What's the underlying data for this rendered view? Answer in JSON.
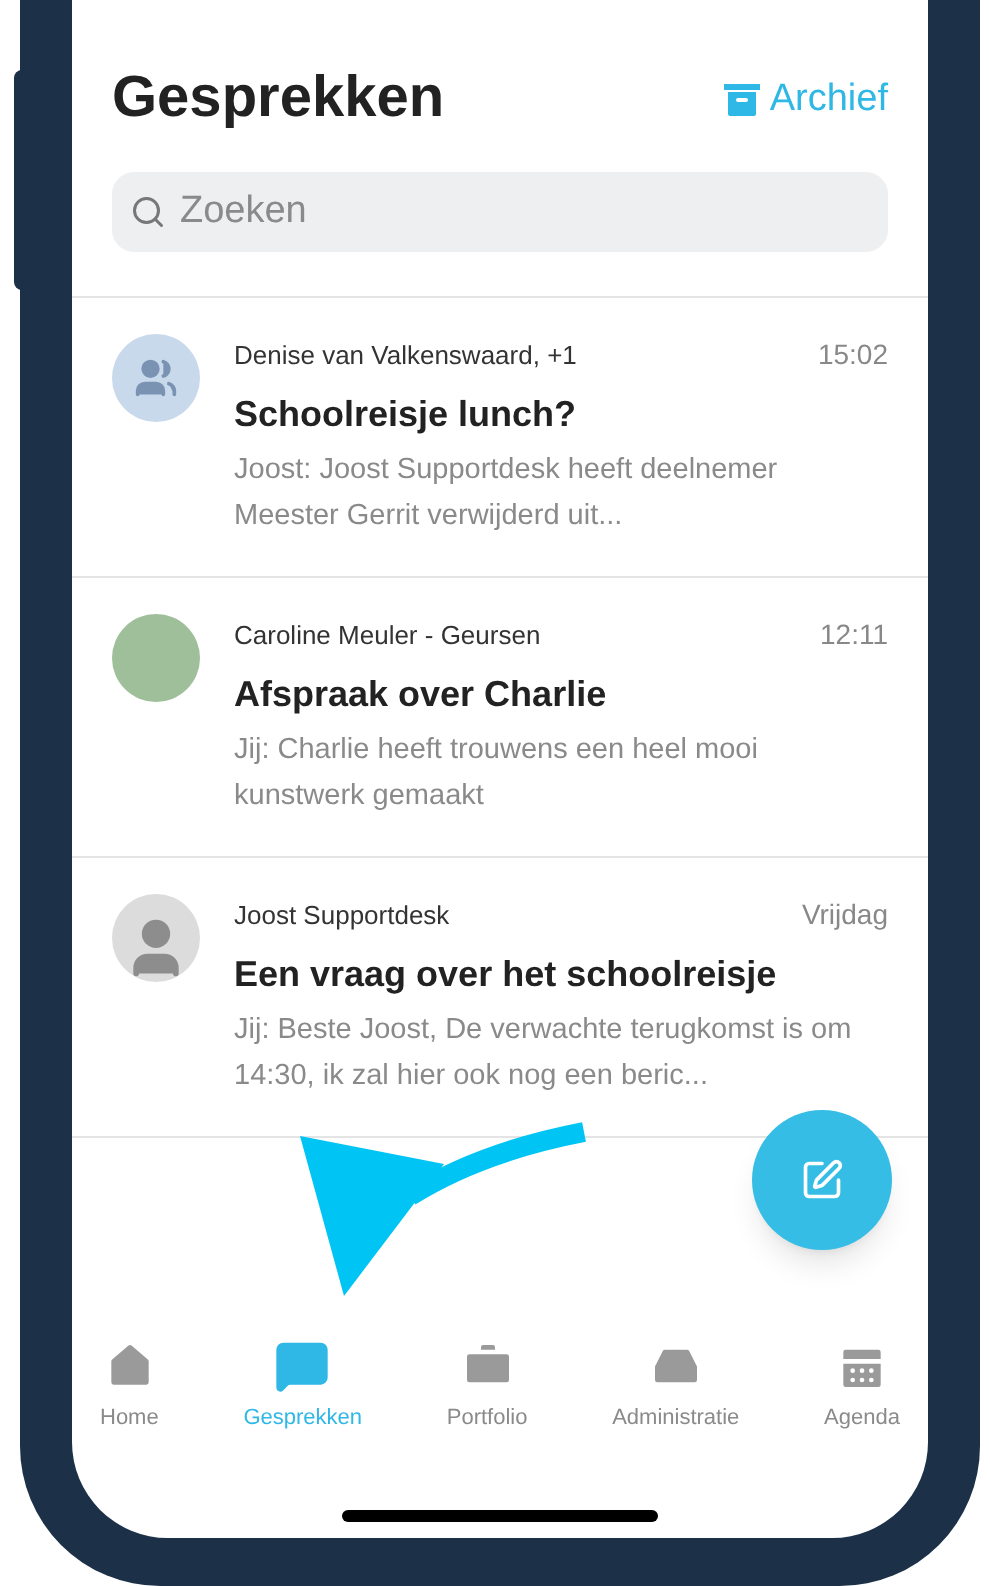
{
  "header": {
    "title": "Gesprekken",
    "archive_link": "Archief"
  },
  "search": {
    "placeholder": "Zoeken"
  },
  "conversations": [
    {
      "kind": "group",
      "participants": "Denise van Valkenswaard, +1",
      "time": "15:02",
      "subject": "Schoolreisje lunch?",
      "preview": "Joost: Joost Supportdesk heeft deelnemer Meester Gerrit verwijderd uit..."
    },
    {
      "kind": "photo",
      "participants": "Caroline Meuler - Geursen",
      "time": "12:11",
      "subject": "Afspraak over Charlie",
      "preview": "Jij: Charlie heeft trouwens een heel mooi kunstwerk gemaakt"
    },
    {
      "kind": "person",
      "participants": "Joost Supportdesk",
      "time": "Vrijdag",
      "subject": "Een vraag over het schoolreisje",
      "preview": "Jij: Beste Joost, De verwachte terugkomst is om 14:30, ik zal hier ook nog een beric..."
    }
  ],
  "tab_bar": [
    {
      "kind": "home",
      "label": "Home",
      "selected": false
    },
    {
      "kind": "chat",
      "label": "Gesprekken",
      "selected": true
    },
    {
      "kind": "portfolio",
      "label": "Portfolio",
      "selected": false
    },
    {
      "kind": "admin",
      "label": "Administratie",
      "selected": false
    },
    {
      "kind": "agenda",
      "label": "Agenda",
      "selected": false
    }
  ]
}
